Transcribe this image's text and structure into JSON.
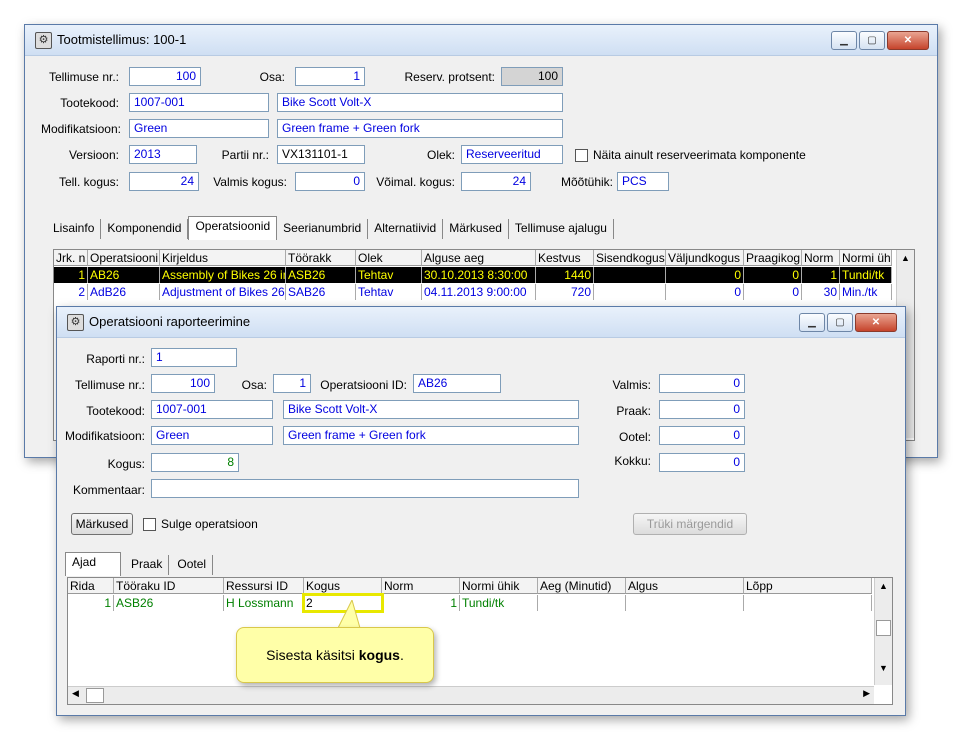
{
  "main": {
    "title": "Tootmistellimus: 100-1",
    "fields": {
      "tellimuse_nr_label": "Tellimuse nr.:",
      "tellimuse_nr": "100",
      "osa_label": "Osa:",
      "osa": "1",
      "reserv_label": "Reserv. protsent:",
      "reserv": "100",
      "tootekood_label": "Tootekood:",
      "tootekood": "1007-001",
      "toote_nimi": "Bike Scott Volt-X",
      "modifikatsioon_label": "Modifikatsioon:",
      "modifikatsioon": "Green",
      "mod_kirjeldus": "Green frame + Green fork",
      "versioon_label": "Versioon:",
      "versioon": "2013",
      "partii_label": "Partii nr.:",
      "partii": "VX131101-1",
      "olek_label": "Olek:",
      "olek": "Reserveeritud",
      "naita_label": "Näita ainult reserveerimata komponente",
      "tell_kogus_label": "Tell. kogus:",
      "tell_kogus": "24",
      "valmis_kogus_label": "Valmis kogus:",
      "valmis_kogus": "0",
      "voimal_kogus_label": "Võimal. kogus:",
      "voimal_kogus": "24",
      "mootuhik_label": "Mõõtühik:",
      "mootuhik": "PCS"
    },
    "tabs": [
      "Lisainfo",
      "Komponendid",
      "Operatsioonid",
      "Seerianumbrid",
      "Alternatiivid",
      "Märkused",
      "Tellimuse ajalugu"
    ],
    "grid_headers": [
      "Jrk. n",
      "Operatsiooni",
      "Kirjeldus",
      "Töörakk",
      "Olek",
      "Alguse aeg",
      "Kestvus",
      "Sisendkogus",
      "Väljundkogus",
      "Praagikog",
      "Norm",
      "Normi üh"
    ],
    "grid_rows": [
      [
        "1",
        "AB26",
        "Assembly of Bikes 26 in",
        "ASB26",
        "Tehtav",
        "30.10.2013 8:30:00",
        "1440",
        "",
        "0",
        "0",
        "1",
        "Tundi/tk"
      ],
      [
        "2",
        "AdB26",
        "Adjustment of Bikes 26",
        "SAB26",
        "Tehtav",
        "04.11.2013 9:00:00",
        "720",
        "",
        "0",
        "0",
        "30",
        "Min./tk"
      ]
    ]
  },
  "dialog": {
    "title": "Operatsiooni raporteerimine",
    "fields": {
      "raporti_nr_label": "Raporti nr.:",
      "raporti_nr": "1",
      "tellimuse_nr_label": "Tellimuse nr.:",
      "tellimuse_nr": "100",
      "osa_label": "Osa:",
      "osa": "1",
      "operatsiooni_id_label": "Operatsiooni ID:",
      "operatsiooni_id": "AB26",
      "tootekood_label": "Tootekood:",
      "tootekood": "1007-001",
      "toote_nimi": "Bike Scott Volt-X",
      "modifikatsioon_label": "Modifikatsioon:",
      "modifikatsioon": "Green",
      "mod_kirjeldus": "Green frame + Green fork",
      "kogus_label": "Kogus:",
      "kogus": "8",
      "kommentaar_label": "Kommentaar:",
      "kommentaar": "",
      "valmis_label": "Valmis:",
      "valmis": "0",
      "praak_label": "Praak:",
      "praak": "0",
      "ootel_label": "Ootel:",
      "ootel": "0",
      "kokku_label": "Kokku:",
      "kokku": "0"
    },
    "markused_button": "Märkused",
    "sulge_label": "Sulge operatsioon",
    "truki_button": "Trüki märgendid",
    "tabs": [
      "Ajad",
      "Praak",
      "Ootel"
    ],
    "grid_headers": [
      "Rida",
      "Tööraku ID",
      "Ressursi ID",
      "Kogus",
      "Norm",
      "Normi ühik",
      "Aeg (Minutid)",
      "Algus",
      "Lõpp"
    ],
    "grid_row": [
      "1",
      "ASB26",
      "H Lossmann",
      "2",
      "1",
      "Tundi/tk",
      "",
      "",
      ""
    ]
  },
  "callout": {
    "text_prefix": "Sisesta käsitsi ",
    "text_bold": "kogus",
    "text_suffix": "."
  }
}
